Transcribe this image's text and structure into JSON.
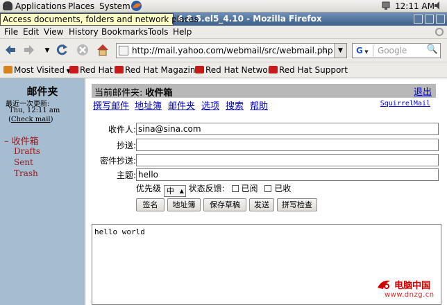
{
  "panel": {
    "applications": "Applications",
    "places": "Places",
    "system": "System",
    "clock": "12:11 AM"
  },
  "tooltip": "Access documents, folders and network places",
  "window": {
    "title_fragment": ".4.8-5.el5_4.10 - Mozilla Firefox"
  },
  "menubar": {
    "items": [
      "File",
      "Edit",
      "View",
      "History",
      "Bookmarks",
      "Tools",
      "Help"
    ]
  },
  "navbar": {
    "url": "http://mail.yahoo.com/webmail/src/webmail.php",
    "search_engine": "G",
    "search_placeholder": "Google"
  },
  "bookmarks": {
    "items": [
      "Most Visited",
      "Red Hat",
      "Red Hat Magazine",
      "Red Hat Network",
      "Red Hat Support"
    ]
  },
  "left_frame": {
    "title": "邮件夹",
    "last_refresh": "最近一次更新:",
    "time": "Thu, 12:11 am",
    "check_mail_prefix": "(",
    "check_mail": "Check mail",
    "check_mail_suffix": ")",
    "inbox_prefix": "– ",
    "folders": [
      "收件箱",
      "Drafts",
      "Sent",
      "Trash"
    ]
  },
  "compose": {
    "current_folder_label": "当前邮件夹:",
    "current_folder": "收件箱",
    "logout": "退出",
    "links": [
      "撰写邮件",
      "地址簿",
      "邮件夹",
      "选项",
      "搜索",
      "帮助"
    ],
    "squirrelmail": "SquirrelMail",
    "to_label": "收件人:",
    "to_value": "sina@sina.com",
    "cc_label": "抄送:",
    "cc_value": "",
    "bcc_label": "密件抄送:",
    "bcc_value": "",
    "subject_label": "主题:",
    "subject_value": "hello",
    "priority_label": "优先级",
    "priority_value": "中",
    "receipt_label": "状态反馈:",
    "receipt_read": "已阅",
    "receipt_delivered": "已收",
    "buttons": [
      "签名",
      "地址簿",
      "保存草稿",
      "发送",
      "拼写检查"
    ],
    "body": "hello world"
  },
  "watermark": {
    "name": "电脑中国",
    "url": "www.dnzg.cn"
  }
}
